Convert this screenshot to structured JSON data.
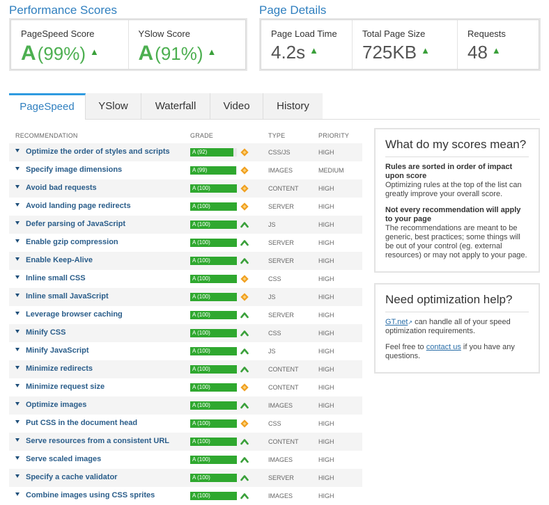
{
  "performance": {
    "title": "Performance Scores",
    "pagespeed": {
      "label": "PageSpeed Score",
      "grade": "A",
      "score": "(99%)"
    },
    "yslow": {
      "label": "YSlow Score",
      "grade": "A",
      "score": "(91%)"
    }
  },
  "details": {
    "title": "Page Details",
    "load_time": {
      "label": "Page Load Time",
      "value": "4.2s"
    },
    "page_size": {
      "label": "Total Page Size",
      "value": "725KB"
    },
    "requests": {
      "label": "Requests",
      "value": "48"
    }
  },
  "tabs": [
    "PageSpeed",
    "YSlow",
    "Waterfall",
    "Video",
    "History"
  ],
  "active_tab": "PageSpeed",
  "table": {
    "headers": {
      "recommendation": "RECOMMENDATION",
      "grade": "GRADE",
      "type": "TYPE",
      "priority": "PRIORITY"
    },
    "rows": [
      {
        "name": "Optimize the order of styles and scripts",
        "grade": "A (92)",
        "score": 92,
        "indicator": "diamond-icon",
        "type": "CSS/JS",
        "priority": "HIGH"
      },
      {
        "name": "Specify image dimensions",
        "grade": "A (99)",
        "score": 99,
        "indicator": "diamond-icon",
        "type": "IMAGES",
        "priority": "MEDIUM"
      },
      {
        "name": "Avoid bad requests",
        "grade": "A (100)",
        "score": 100,
        "indicator": "diamond-icon",
        "type": "CONTENT",
        "priority": "HIGH"
      },
      {
        "name": "Avoid landing page redirects",
        "grade": "A (100)",
        "score": 100,
        "indicator": "diamond-icon",
        "type": "SERVER",
        "priority": "HIGH"
      },
      {
        "name": "Defer parsing of JavaScript",
        "grade": "A (100)",
        "score": 100,
        "indicator": "chevron-up-icon",
        "type": "JS",
        "priority": "HIGH"
      },
      {
        "name": "Enable gzip compression",
        "grade": "A (100)",
        "score": 100,
        "indicator": "chevron-up-icon",
        "type": "SERVER",
        "priority": "HIGH"
      },
      {
        "name": "Enable Keep-Alive",
        "grade": "A (100)",
        "score": 100,
        "indicator": "chevron-up-icon",
        "type": "SERVER",
        "priority": "HIGH"
      },
      {
        "name": "Inline small CSS",
        "grade": "A (100)",
        "score": 100,
        "indicator": "diamond-icon",
        "type": "CSS",
        "priority": "HIGH"
      },
      {
        "name": "Inline small JavaScript",
        "grade": "A (100)",
        "score": 100,
        "indicator": "diamond-icon",
        "type": "JS",
        "priority": "HIGH"
      },
      {
        "name": "Leverage browser caching",
        "grade": "A (100)",
        "score": 100,
        "indicator": "chevron-up-icon",
        "type": "SERVER",
        "priority": "HIGH"
      },
      {
        "name": "Minify CSS",
        "grade": "A (100)",
        "score": 100,
        "indicator": "chevron-up-icon",
        "type": "CSS",
        "priority": "HIGH"
      },
      {
        "name": "Minify JavaScript",
        "grade": "A (100)",
        "score": 100,
        "indicator": "chevron-up-icon",
        "type": "JS",
        "priority": "HIGH"
      },
      {
        "name": "Minimize redirects",
        "grade": "A (100)",
        "score": 100,
        "indicator": "chevron-up-icon",
        "type": "CONTENT",
        "priority": "HIGH"
      },
      {
        "name": "Minimize request size",
        "grade": "A (100)",
        "score": 100,
        "indicator": "diamond-icon",
        "type": "CONTENT",
        "priority": "HIGH"
      },
      {
        "name": "Optimize images",
        "grade": "A (100)",
        "score": 100,
        "indicator": "chevron-up-icon",
        "type": "IMAGES",
        "priority": "HIGH"
      },
      {
        "name": "Put CSS in the document head",
        "grade": "A (100)",
        "score": 100,
        "indicator": "diamond-icon",
        "type": "CSS",
        "priority": "HIGH"
      },
      {
        "name": "Serve resources from a consistent URL",
        "grade": "A (100)",
        "score": 100,
        "indicator": "chevron-up-icon",
        "type": "CONTENT",
        "priority": "HIGH"
      },
      {
        "name": "Serve scaled images",
        "grade": "A (100)",
        "score": 100,
        "indicator": "chevron-up-icon",
        "type": "IMAGES",
        "priority": "HIGH"
      },
      {
        "name": "Specify a cache validator",
        "grade": "A (100)",
        "score": 100,
        "indicator": "chevron-up-icon",
        "type": "SERVER",
        "priority": "HIGH"
      },
      {
        "name": "Combine images using CSS sprites",
        "grade": "A (100)",
        "score": 100,
        "indicator": "chevron-up-icon",
        "type": "IMAGES",
        "priority": "HIGH"
      }
    ]
  },
  "scores_box": {
    "title": "What do my scores mean?",
    "h1": "Rules are sorted in order of impact upon score",
    "p1": "Optimizing rules at the top of the list can greatly improve your overall score.",
    "h2": "Not every recommendation will apply to your page",
    "p2": "The recommendations are meant to be generic, best practices; some things will be out of your control (eg. external resources) or may not apply to your page."
  },
  "help_box": {
    "title": "Need optimization help?",
    "link": "GT.net",
    "text1": " can handle all of your speed optimization requirements.",
    "text2a": "Feel free to ",
    "contact": "contact us",
    "text2b": " if you have any questions."
  },
  "colors": {
    "accent": "#2f7fbf",
    "grade_green": "#2fa82f",
    "diamond_orange": "#f0a020",
    "chevron_green": "#3aa03a"
  }
}
